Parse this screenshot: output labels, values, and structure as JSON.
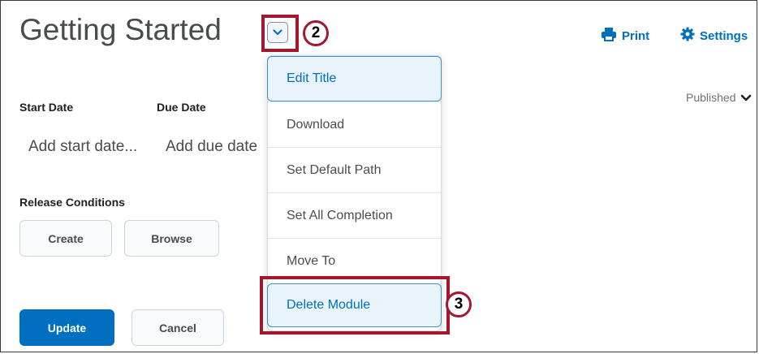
{
  "page": {
    "title": "Getting Started"
  },
  "header": {
    "dropdown_icon": "chevron-down-icon",
    "print": {
      "label": "Print",
      "icon": "printer-icon"
    },
    "settings": {
      "label": "Settings",
      "icon": "gear-icon"
    }
  },
  "callouts": {
    "step2": "2",
    "step3": "3"
  },
  "fields": {
    "start_date_label": "Start Date",
    "due_date_label": "Due Date",
    "start_date_placeholder": "Add start date...",
    "due_date_placeholder": "Add due date",
    "release_conditions_label": "Release Conditions"
  },
  "status": {
    "label": "Published",
    "icon": "chevron-down-icon"
  },
  "buttons": {
    "create": "Create",
    "browse": "Browse",
    "update": "Update",
    "cancel": "Cancel"
  },
  "menu": {
    "items": [
      {
        "label": "Edit Title"
      },
      {
        "label": "Download"
      },
      {
        "label": "Set Default Path"
      },
      {
        "label": "Set All Completion"
      },
      {
        "label": "Move To"
      },
      {
        "label": "Delete Module"
      }
    ]
  },
  "colors": {
    "accent": "#006fbf",
    "callout": "#a4172f",
    "menu_highlight": "#e8f3fc"
  }
}
